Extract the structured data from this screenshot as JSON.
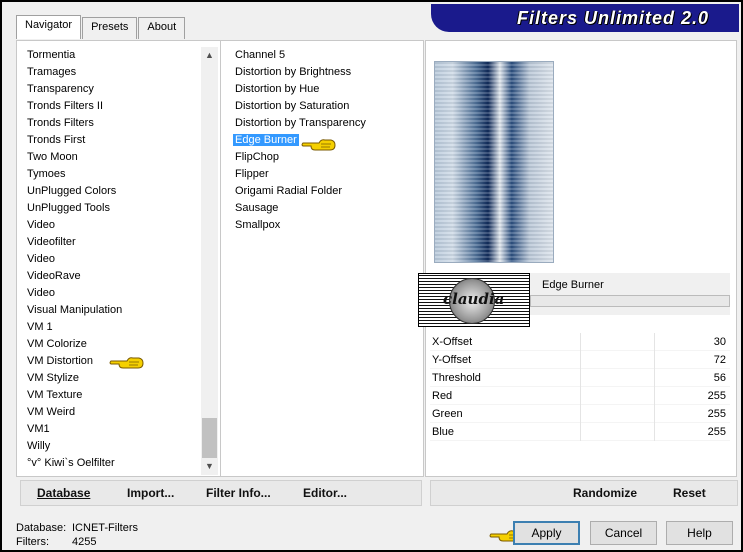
{
  "banner": {
    "title": "Filters Unlimited 2.0"
  },
  "tabs": [
    "Navigator",
    "Presets",
    "About"
  ],
  "categories": [
    "Tormentia",
    "Tramages",
    "Transparency",
    "Tronds Filters II",
    "Tronds Filters",
    "Tronds First",
    "Two Moon",
    "Tymoes",
    "UnPlugged Colors",
    "UnPlugged Tools",
    "Video",
    "Videofilter",
    "Video",
    "VideoRave",
    "Video",
    "Visual Manipulation",
    "VM 1",
    "VM Colorize",
    "VM Distortion",
    "VM Stylize",
    "VM Texture",
    "VM Weird",
    "VM1",
    "Willy",
    "°v° Kiwi`s Oelfilter"
  ],
  "filters": [
    "Channel 5",
    "Distortion by Brightness",
    "Distortion by Hue",
    "Distortion by Saturation",
    "Distortion by Transparency",
    "Edge Burner",
    "FlipChop",
    "Flipper",
    "Origami Radial Folder",
    "Sausage",
    "Smallpox"
  ],
  "selected_filter": "Edge Burner",
  "logo_text": "claudia",
  "filter_display_name": "Edge Burner",
  "params": [
    {
      "name": "X-Offset",
      "value": "30"
    },
    {
      "name": "Y-Offset",
      "value": "72"
    },
    {
      "name": "Threshold",
      "value": "56"
    },
    {
      "name": "Red",
      "value": "255"
    },
    {
      "name": "Green",
      "value": "255"
    },
    {
      "name": "Blue",
      "value": "255"
    }
  ],
  "bottom_left": {
    "database": "Database",
    "import": "Import...",
    "filter_info": "Filter Info...",
    "editor": "Editor..."
  },
  "bottom_right": {
    "randomize": "Randomize",
    "reset": "Reset"
  },
  "status": {
    "database_label": "Database:",
    "database_value": "ICNET-Filters",
    "filters_label": "Filters:",
    "filters_value": "4255"
  },
  "buttons": {
    "apply": "Apply",
    "cancel": "Cancel",
    "help": "Help"
  },
  "colors": {
    "banner": "#1a1a8c",
    "selection": "#3399ff",
    "hand": "#f5d000"
  }
}
